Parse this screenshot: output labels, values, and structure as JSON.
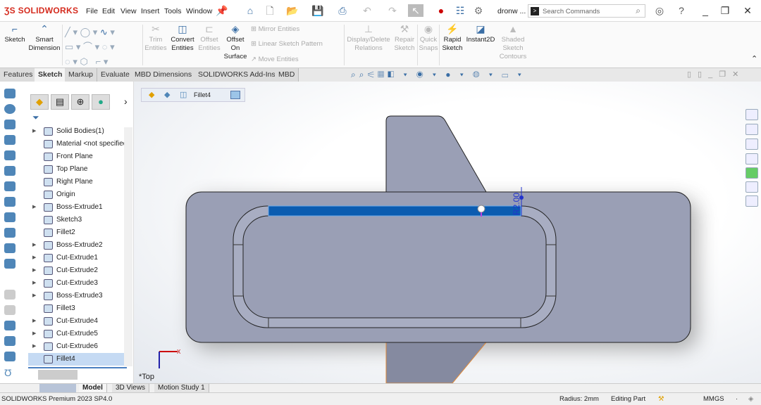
{
  "app": {
    "logo": "SOLIDWORKS",
    "file_short": "dronw ...",
    "accent": "#d52b1e"
  },
  "menu": [
    "File",
    "Edit",
    "View",
    "Insert",
    "Tools",
    "Window"
  ],
  "search": {
    "placeholder": "Search Commands"
  },
  "ribbon": {
    "sketch": "Sketch",
    "smart_dimension": "Smart Dimension",
    "trim": "Trim Entities",
    "convert": "Convert Entities",
    "offset": "Offset Entities",
    "offset_surface": "Offset On Surface",
    "mirror": "Mirror Entities",
    "linear_pattern": "Linear Sketch Pattern",
    "move": "Move Entities",
    "display_delete": "Display/Delete Relations",
    "repair": "Repair Sketch",
    "quick_snaps": "Quick Snaps",
    "rapid": "Rapid Sketch",
    "instant2d": "Instant2D",
    "shaded": "Shaded Sketch Contours"
  },
  "tabs": [
    {
      "label": "Features"
    },
    {
      "label": "Sketch",
      "active": true
    },
    {
      "label": "Markup"
    },
    {
      "label": "Evaluate"
    },
    {
      "label": "MBD Dimensions"
    },
    {
      "label": "SOLIDWORKS Add-Ins"
    },
    {
      "label": "MBD"
    }
  ],
  "tree": {
    "items": [
      {
        "label": "Solid Bodies(1)",
        "expand": true
      },
      {
        "label": "Material <not specified>"
      },
      {
        "label": "Front Plane"
      },
      {
        "label": "Top Plane"
      },
      {
        "label": "Right Plane"
      },
      {
        "label": "Origin"
      },
      {
        "label": "Boss-Extrude1",
        "expand": true
      },
      {
        "label": "Sketch3"
      },
      {
        "label": "Fillet2"
      },
      {
        "label": "Boss-Extrude2",
        "expand": true
      },
      {
        "label": "Cut-Extrude1",
        "expand": true
      },
      {
        "label": "Cut-Extrude2",
        "expand": true
      },
      {
        "label": "Cut-Extrude3",
        "expand": true
      },
      {
        "label": "Boss-Extrude3",
        "expand": true
      },
      {
        "label": "Fillet3"
      },
      {
        "label": "Cut-Extrude4",
        "expand": true
      },
      {
        "label": "Cut-Extrude5",
        "expand": true
      },
      {
        "label": "Cut-Extrude6",
        "expand": true
      },
      {
        "label": "Fillet4",
        "selected": true
      }
    ]
  },
  "viewport": {
    "breadcrumb": "Fillet4",
    "view_name": "*Top",
    "dimension": "R2.00",
    "part_color": "#9a9fb5",
    "selected_edge_color": "#0b5cb0"
  },
  "bottom_tabs": [
    {
      "label": "Model",
      "active": true
    },
    {
      "label": "3D Views"
    },
    {
      "label": "Motion Study 1"
    }
  ],
  "status": {
    "product": "SOLIDWORKS Premium 2023 SP4.0",
    "radius": "Radius: 2mm",
    "mode": "Editing Part",
    "units": "MMGS"
  }
}
